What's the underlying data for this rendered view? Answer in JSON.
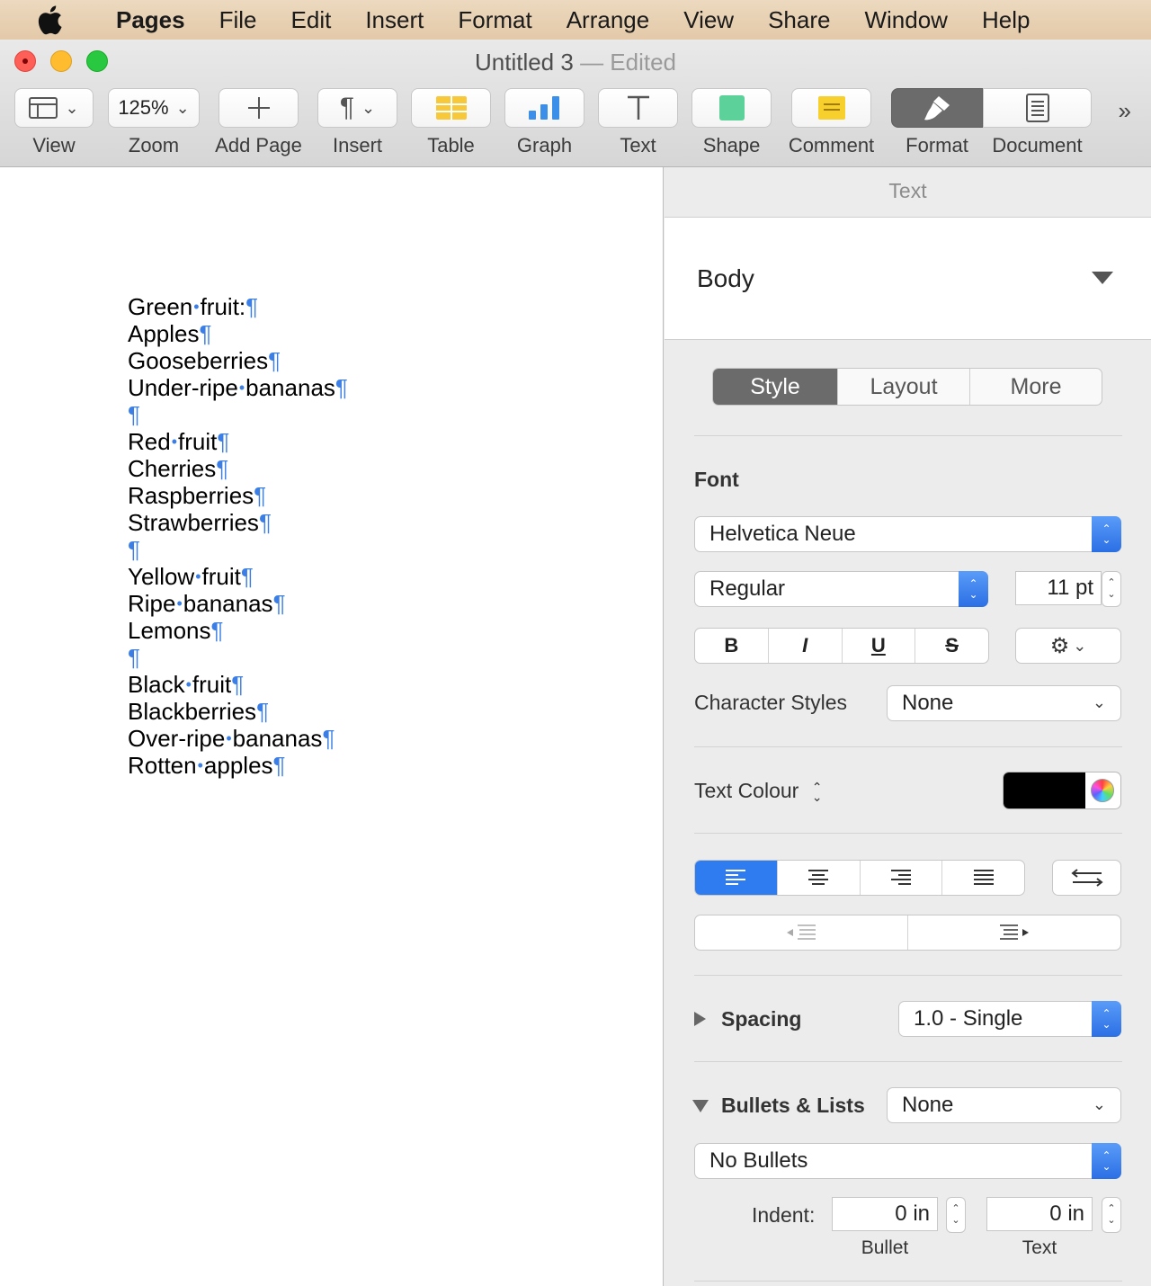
{
  "menubar": {
    "items": [
      "Pages",
      "File",
      "Edit",
      "Insert",
      "Format",
      "Arrange",
      "View",
      "Share",
      "Window",
      "Help"
    ]
  },
  "window": {
    "title": "Untitled 3",
    "status": "— Edited"
  },
  "toolbar": {
    "view_label": "View",
    "zoom_value": "125%",
    "zoom_label": "Zoom",
    "add_page_label": "Add Page",
    "insert_label": "Insert",
    "table_label": "Table",
    "graph_label": "Graph",
    "text_label": "Text",
    "shape_label": "Shape",
    "comment_label": "Comment",
    "format_label": "Format",
    "document_label": "Document"
  },
  "document": {
    "lines": [
      [
        "Green",
        "fruit:"
      ],
      [
        "Apples"
      ],
      [
        "Gooseberries"
      ],
      [
        "Under-ripe",
        "bananas"
      ],
      [],
      [
        "Red",
        "fruit"
      ],
      [
        "Cherries"
      ],
      [
        "Raspberries"
      ],
      [
        "Strawberries"
      ],
      [],
      [
        "Yellow",
        "fruit"
      ],
      [
        "Ripe",
        "bananas"
      ],
      [
        "Lemons"
      ],
      [],
      [
        "Black",
        "fruit"
      ],
      [
        "Blackberries"
      ],
      [
        "Over-ripe",
        "bananas"
      ],
      [
        "Rotten",
        "apples"
      ]
    ]
  },
  "inspector": {
    "header": "Text",
    "paragraph_style": "Body",
    "tabs": [
      "Style",
      "Layout",
      "More"
    ],
    "font_label": "Font",
    "font_family": "Helvetica Neue",
    "font_typeface": "Regular",
    "font_size": "11 pt",
    "bold": "B",
    "italic": "I",
    "underline": "U",
    "strike": "S",
    "character_styles_label": "Character Styles",
    "character_styles_value": "None",
    "text_colour_label": "Text Colour",
    "text_colour": "#000000",
    "spacing_label": "Spacing",
    "spacing_value": "1.0 - Single",
    "bullets_label": "Bullets & Lists",
    "bullets_value": "None",
    "bullet_type": "No Bullets",
    "indent_label": "Indent:",
    "indent_bullet_value": "0 in",
    "indent_text_value": "0 in",
    "indent_bullet_caption": "Bullet",
    "indent_text_caption": "Text"
  },
  "colors": {
    "accent": "#2f7cf1",
    "invisibles": "#3a7ee6"
  }
}
